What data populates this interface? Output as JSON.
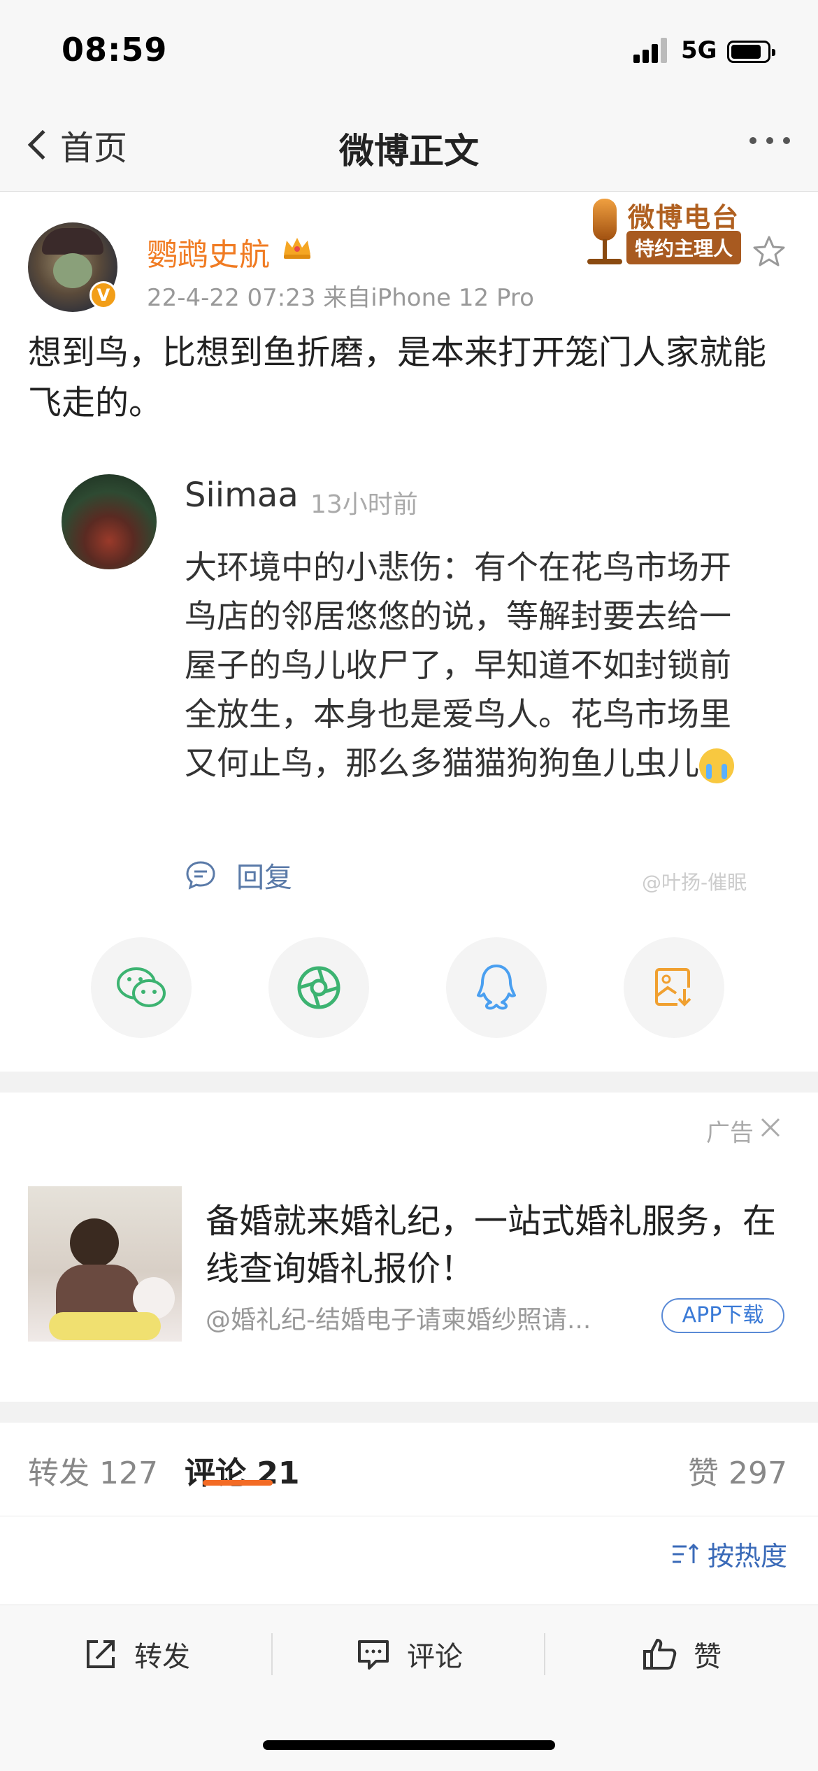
{
  "status_bar": {
    "time": "08:59",
    "network": "5G"
  },
  "nav": {
    "back_label": "首页",
    "title": "微博正文"
  },
  "post": {
    "author": "鹦鹉史航",
    "verified_mark": "V",
    "meta": "22-4-22 07:23  来自iPhone 12 Pro",
    "badge_title": "微博电台",
    "badge_subtitle": "特约主理人",
    "text": "想到鸟，比想到鱼折磨，是本来打开笼门人家就能飞走的。"
  },
  "embedded_comment": {
    "name": "Siimaa",
    "time": "13小时前",
    "text": "大环境中的小悲伤：有个在花鸟市场开鸟店的邻居悠悠的说，等解封要去给一屋子的鸟儿收尸了，早知道不如封锁前全放生，本身也是爱鸟人。花鸟市场里又何止鸟，那么多猫猫狗狗鱼儿虫儿",
    "reply_label": "回复",
    "watermark": "@叶扬-催眠"
  },
  "share": {
    "icons": [
      "wechat-icon",
      "moments-icon",
      "qq-icon",
      "save-image-icon"
    ],
    "colors": {
      "green": "#3cb371",
      "blue": "#4a9ff0",
      "orange": "#f0a030"
    }
  },
  "ad": {
    "label": "广告",
    "title": "备婚就来婚礼纪，一站式婚礼服务，在线查询婚礼报价！",
    "source": "@婚礼纪-结婚电子请柬婚纱照请...",
    "button": "APP下载"
  },
  "tabs": {
    "repost": "转发 127",
    "comment": "评论 21",
    "like": "赞 297",
    "active": "comment"
  },
  "sort": {
    "label": "按热度"
  },
  "toolbar": {
    "repost": "转发",
    "comment": "评论",
    "like": "赞"
  },
  "colors": {
    "accent": "#f36b25",
    "username": "#f07b22",
    "link": "#3a6ab8"
  }
}
